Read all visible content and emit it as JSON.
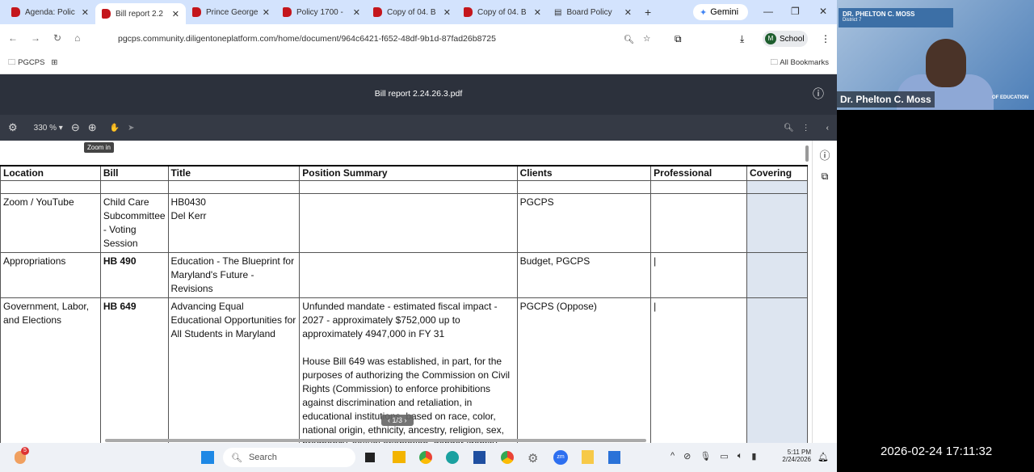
{
  "browser": {
    "tabs": [
      {
        "label": "Agenda: Polic"
      },
      {
        "label": "Bill report 2.2"
      },
      {
        "label": "Prince George"
      },
      {
        "label": "Policy 1700 -"
      },
      {
        "label": "Copy of 04. B"
      },
      {
        "label": "Copy of 04. B"
      },
      {
        "label": "Board Policy"
      }
    ],
    "gemini": "Gemini",
    "url": "pgcps.community.diligentoneplatform.com/home/document/964c6421-f652-48df-9b1d-87fad26b8725",
    "profile": "School",
    "profile_initial": "M",
    "bookmark": "PGCPS",
    "all_bookmarks": "All Bookmarks"
  },
  "viewer": {
    "title": "Bill report 2.24.26.3.pdf",
    "zoom": "330 %",
    "tooltip": "Zoom in",
    "pager": "1/3"
  },
  "table": {
    "headers": [
      "Location",
      "Bill",
      "Title",
      "Position Summary",
      "Clients",
      "Professional",
      "Covering"
    ],
    "rows": [
      {
        "location": "Zoom / YouTube",
        "bill": "Child Care Subcommittee - Voting Session",
        "title": "HB0430\nDel Kerr",
        "summary": "",
        "clients": "PGCPS",
        "professional": ""
      },
      {
        "location": "Appropriations",
        "bill": "HB 490",
        "title": "Education - The Blueprint for Maryland's Future - Revisions",
        "summary": "",
        "clients": "Budget, PGCPS",
        "professional": "|"
      },
      {
        "location": "Government, Labor, and Elections",
        "bill": "HB 649",
        "title": "Advancing Equal Educational Opportunities for All Students in Maryland",
        "summary": "Unfunded mandate - estimated fiscal impact - 2027 - approximately $752,000 up to approximately 4947,000 in FY 31\n\nHouse Bill 649 was established, in part, for the purposes of authorizing the Commission on Civil Rights (Commission) to enforce prohibitions against discrimination and retaliation, in educational institutions, based on race, color, national origin, ethnicity, ancestry, religion, sex, pregnancy, sexual orientation, gender identity, disability, age, or marital",
        "clients": "PGCPS (Oppose)",
        "professional": "|"
      }
    ]
  },
  "video": {
    "plate_name": "DR. PHELTON C. MOSS",
    "plate_sub": "District 7",
    "name": "Dr. Phelton C. Moss",
    "bg_text": "OF EDUCATION"
  },
  "taskbar": {
    "search": "Search",
    "time": "5:11 PM",
    "date": "2/24/2026",
    "badge": "5"
  },
  "timestamp": "2026-02-24 17:11:32"
}
